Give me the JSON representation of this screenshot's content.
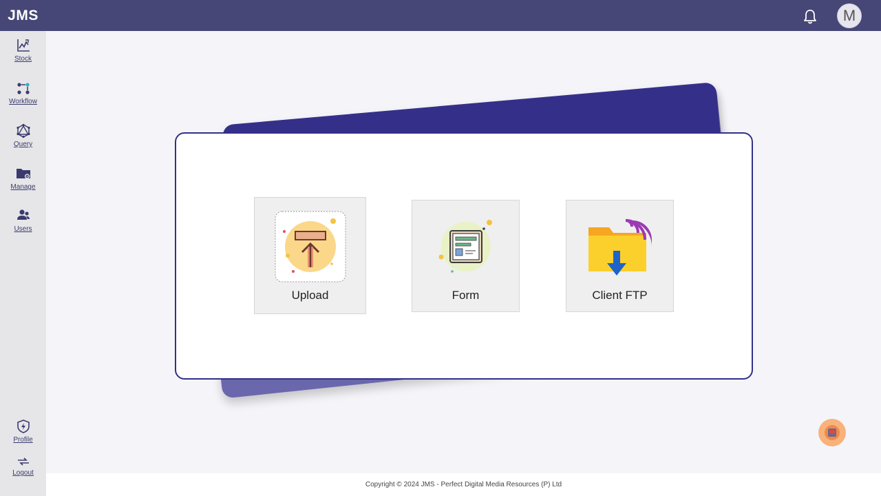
{
  "app": {
    "brand": "JMS",
    "avatar_initial": "M"
  },
  "sidebar": {
    "items": [
      {
        "label": "Stock",
        "icon": "stock-chart-icon"
      },
      {
        "label": "Workflow",
        "icon": "workflow-icon"
      },
      {
        "label": "Query",
        "icon": "query-icon"
      },
      {
        "label": "Manage",
        "icon": "manage-folder-icon"
      },
      {
        "label": "Users",
        "icon": "users-icon"
      }
    ],
    "bottom_items": [
      {
        "label": "Profile",
        "icon": "profile-shield-icon"
      },
      {
        "label": "Logout",
        "icon": "logout-icon"
      }
    ]
  },
  "tiles": [
    {
      "label": "Upload",
      "icon": "upload-icon"
    },
    {
      "label": "Form",
      "icon": "form-icon"
    },
    {
      "label": "Client FTP",
      "icon": "client-ftp-icon"
    }
  ],
  "footer": {
    "text": "Copyright © 2024 JMS - Perfect Digital Media Resources (P) Ltd"
  },
  "colors": {
    "topbar": "#464677",
    "accent": "#31308a",
    "sidebar": "#e6e6e8",
    "help_button": "#f8b27a"
  }
}
